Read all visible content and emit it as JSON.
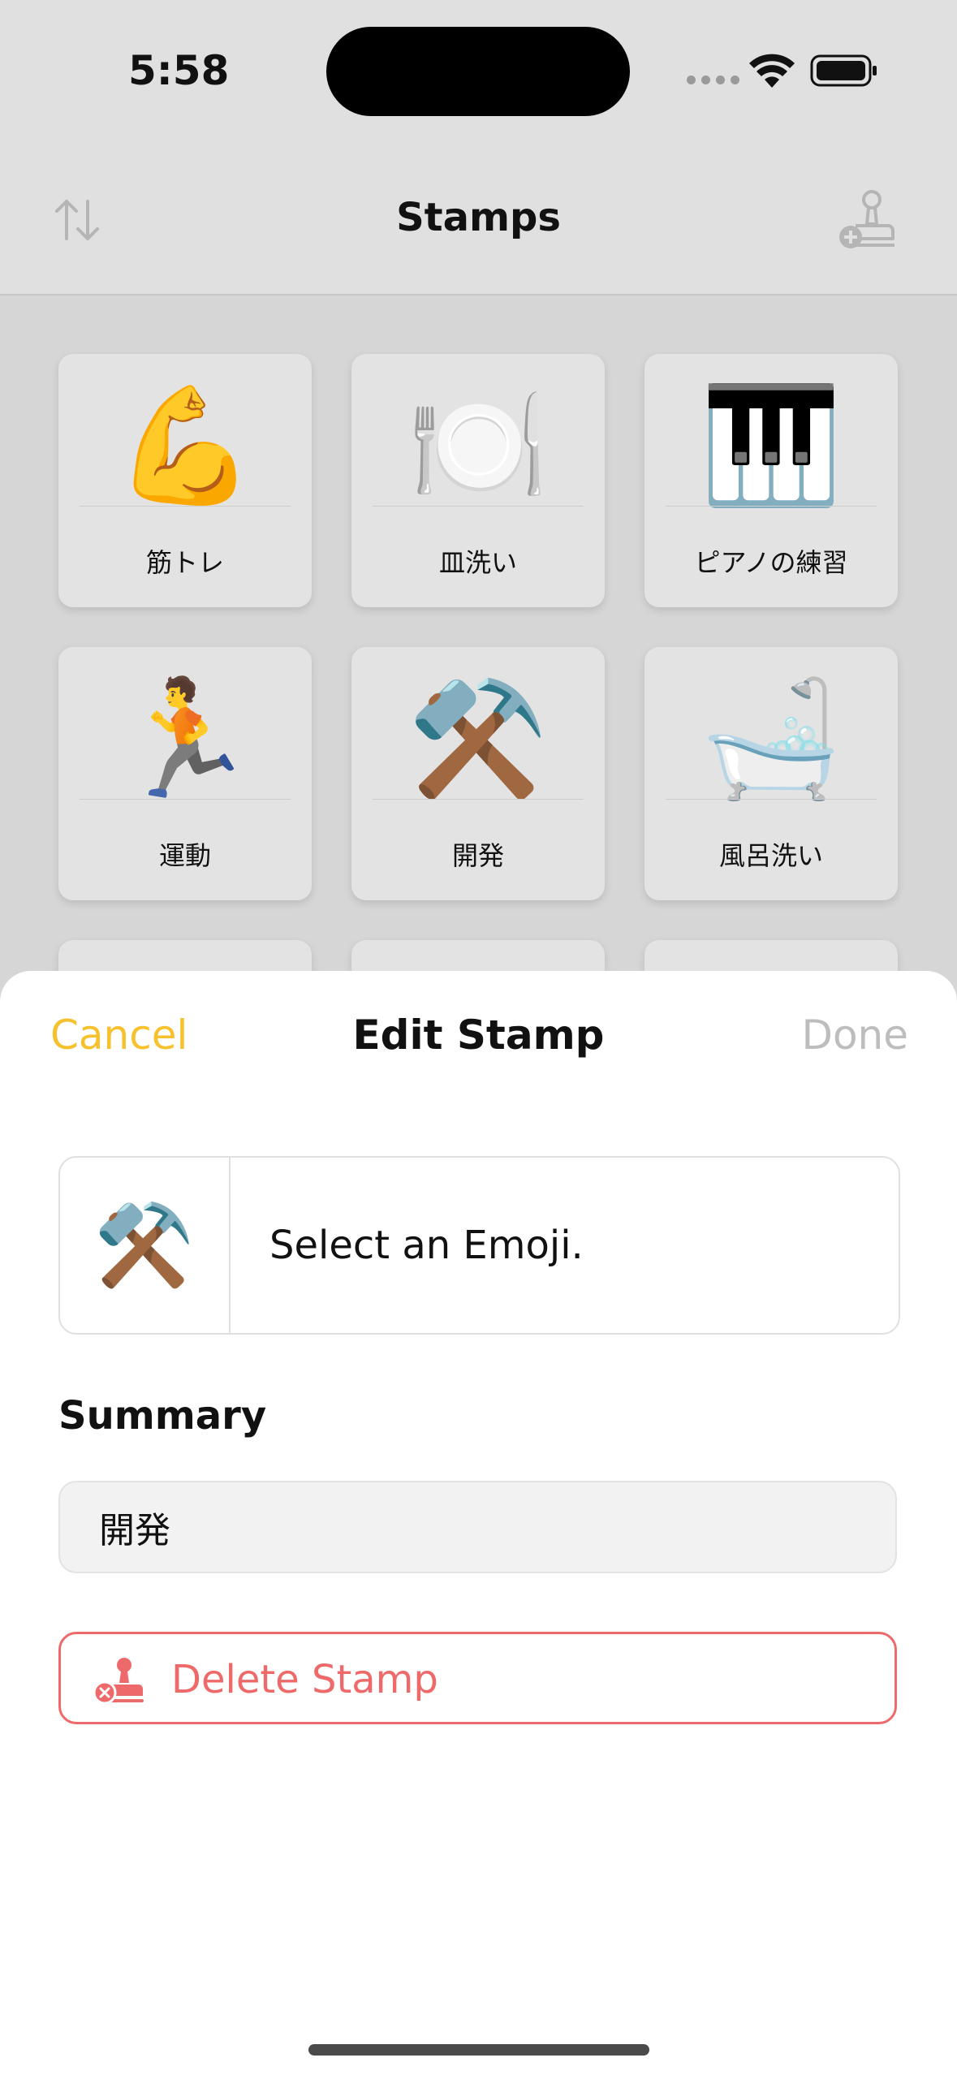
{
  "status_bar": {
    "time": "5:58"
  },
  "nav": {
    "title": "Stamps",
    "left_icon": "sort-arrows-icon",
    "right_icon": "add-stamp-icon"
  },
  "stamps": [
    {
      "emoji": "💪",
      "label": "筋トレ"
    },
    {
      "emoji": "🍽️",
      "label": "皿洗い"
    },
    {
      "emoji": "🎹",
      "label": "ピアノの練習"
    },
    {
      "emoji": "🏃",
      "label": "運動"
    },
    {
      "emoji": "⚒️",
      "label": "開発"
    },
    {
      "emoji": "🛁",
      "label": "風呂洗い"
    }
  ],
  "sheet": {
    "cancel": "Cancel",
    "title": "Edit Stamp",
    "done": "Done",
    "emoji_picker": {
      "emoji": "⚒️",
      "prompt": "Select an Emoji."
    },
    "summary_label": "Summary",
    "summary_value": "開発",
    "delete_label": "Delete Stamp"
  },
  "colors": {
    "accent": "#f6c12d",
    "destructive": "#ee6a6a",
    "disabled": "#bdbdbd"
  }
}
